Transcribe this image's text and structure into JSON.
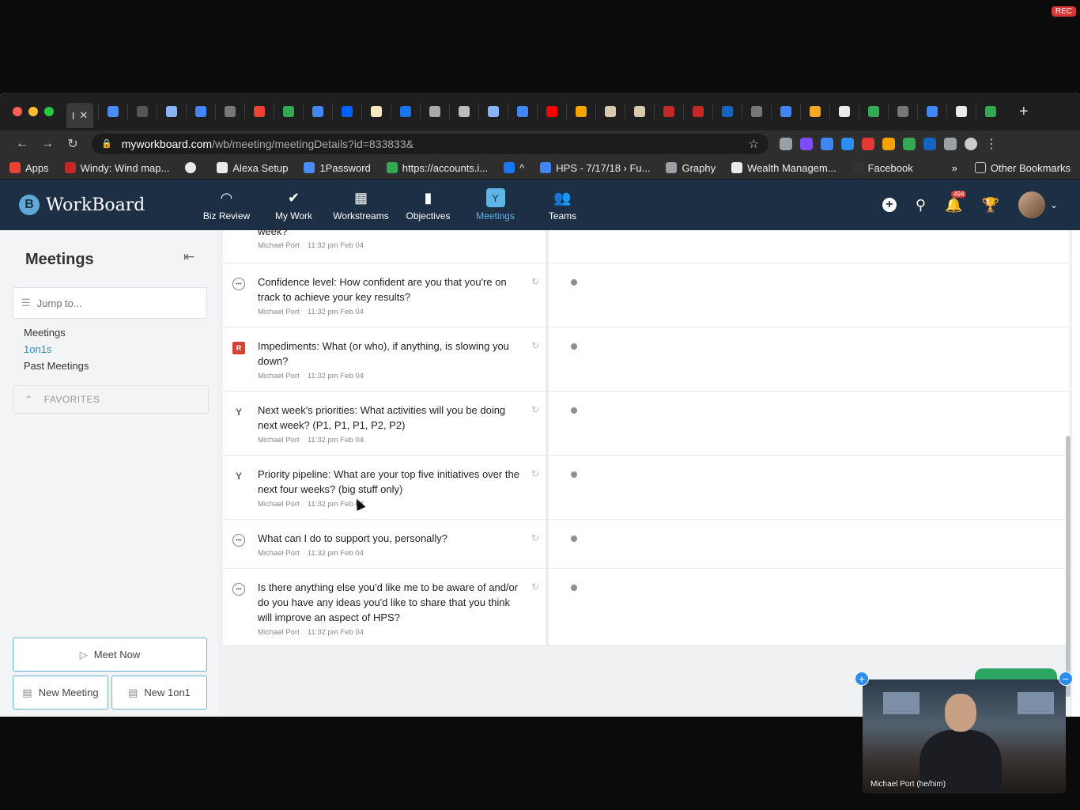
{
  "overlay": {
    "rec_label": "REC"
  },
  "browser": {
    "active_tab_label": "I",
    "tab_colors": [
      "#4c8bf5",
      "#555",
      "#8ab4f8",
      "#4285f4",
      "#777",
      "#ea4335",
      "#34a853",
      "#4285f4",
      "#0061ff",
      "#f6e7c1",
      "#1a73e8",
      "#aaa",
      "#bbb",
      "#8ab4f8",
      "#4285f4",
      "#ff0000",
      "#f4a300",
      "#d9c8b0",
      "#d9c8b0",
      "#c62828",
      "#c62828",
      "#1565c0",
      "#777",
      "#4285f4",
      "#f9a825",
      "#e8eaed",
      "#34a853",
      "#777",
      "#4285f4",
      "#e8eaed",
      "#34a853"
    ],
    "url_host": "myworkboard.com",
    "url_path": "/wb/meeting/meetingDetails?id=833833&",
    "extension_colors": [
      "#9aa0a6",
      "#7c4dff",
      "#4285f4",
      "#2d8cf0",
      "#e53935",
      "#f4a300",
      "#34a853",
      "#1565c0",
      "#9aa0a6",
      "#ccc"
    ],
    "bookmarks": [
      {
        "label": "Apps",
        "color": "#ea4335"
      },
      {
        "label": "Windy: Wind map...",
        "color": "#c62828"
      },
      {
        "label": "",
        "color": "#e8eaed"
      },
      {
        "label": "Alexa Setup",
        "color": "#e8eaed"
      },
      {
        "label": "1Password",
        "color": "#4c8bf5"
      },
      {
        "label": "https://accounts.i...",
        "color": "#34a853"
      },
      {
        "label": "^",
        "color": "#1877f2"
      },
      {
        "label": "HPS - 7/17/18 › Fu...",
        "color": "#4285f4"
      },
      {
        "label": "Graphy",
        "color": "#9aa0a6"
      },
      {
        "label": "Wealth Managem...",
        "color": "#e8eaed"
      },
      {
        "label": "Facebook",
        "color": "#333"
      }
    ],
    "bookmarks_more": "»",
    "other_bookmarks": "Other Bookmarks"
  },
  "app": {
    "logo_text": "WorkBoard",
    "nav": [
      {
        "label": "Biz Review",
        "icon": "◠"
      },
      {
        "label": "My Work",
        "icon": "✔"
      },
      {
        "label": "Workstreams",
        "icon": "▦"
      },
      {
        "label": "Objectives",
        "icon": "▮"
      },
      {
        "label": "Meetings",
        "icon": "Y"
      },
      {
        "label": "Teams",
        "icon": "👥"
      }
    ],
    "notification_count": "494"
  },
  "sidebar": {
    "title": "Meetings",
    "jump_placeholder": "Jump to...",
    "links": [
      "Meetings",
      "1on1s",
      "Past Meetings"
    ],
    "favorites_label": "FAVORITES",
    "meet_now": "Meet Now",
    "new_meeting": "New Meeting",
    "new_1on1": "New 1on1"
  },
  "rows": [
    {
      "question": "week?",
      "author": "Michael Port",
      "time": "11:32 pm Feb 04",
      "icon": "none"
    },
    {
      "question": "Confidence level: How confident are you that you're on track to achieve your key results?",
      "author": "Michael Port",
      "time": "11:32 pm Feb 04",
      "icon": "comment"
    },
    {
      "question": "Impediments: What (or who), if anything, is slowing you down?",
      "author": "Michael Port",
      "time": "11:32 pm Feb 04",
      "icon": "red",
      "icon_label": "R"
    },
    {
      "question": "Next week's priorities: What activities will you be doing next week? (P1, P1, P1, P2, P2)",
      "author": "Michael Port",
      "time": "11:32 pm Feb 04",
      "icon": "branch"
    },
    {
      "question": "Priority pipeline: What are your top five initiatives over the next four weeks? (big stuff only)",
      "author": "Michael Port",
      "time": "11:32 pm Feb 04",
      "icon": "branch"
    },
    {
      "question": "What can I do to support you, personally?",
      "author": "Michael Port",
      "time": "11:32 pm Feb 04",
      "icon": "comment"
    },
    {
      "question": "Is there anything else you'd like me to be aware of and/or do you have any ideas you'd like to share that you think will improve an aspect of HPS?",
      "author": "Michael Port",
      "time": "11:32 pm Feb 04",
      "icon": "comment"
    }
  ],
  "video": {
    "participant_name": "Michael Port (he/him)"
  }
}
